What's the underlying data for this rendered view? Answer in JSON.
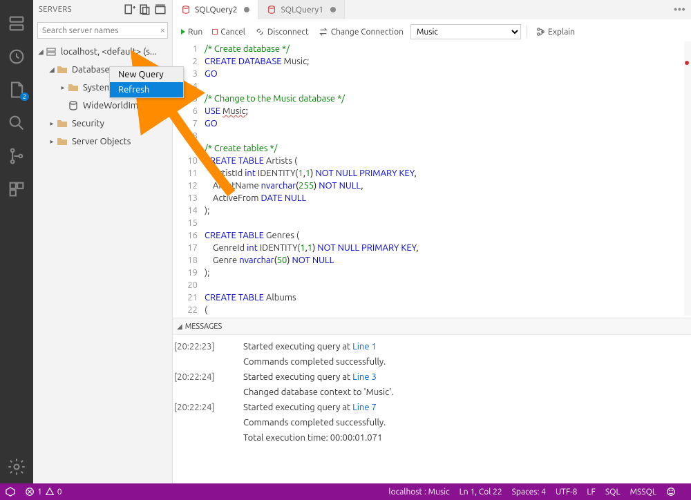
{
  "sidebar": {
    "title": "SERVERS",
    "search_placeholder": "Search server names",
    "tree": {
      "server": "localhost, <default> (s...",
      "databases": "Databases",
      "system": "System",
      "wwi": "WideWorldImpor",
      "security": "Security",
      "server_objects": "Server Objects"
    }
  },
  "activity_badge": "2",
  "context_menu": {
    "item0": "New Query",
    "item1": "Refresh"
  },
  "tabs": {
    "t0": "SQLQuery2",
    "t1": "SQLQuery1"
  },
  "toolbar": {
    "run": "Run",
    "cancel": "Cancel",
    "disconnect": "Disconnect",
    "change": "Change Connection",
    "explain": "Explain",
    "db": "Music"
  },
  "code": {
    "lines": [
      "1",
      "2",
      "3",
      "4",
      "5",
      "6",
      "7",
      "8",
      "9",
      "10",
      "11",
      "12",
      "13",
      "14",
      "15",
      "16",
      "17",
      "18",
      "19",
      "20",
      "21",
      "22"
    ],
    "l1": "/* Create database */",
    "l2a": "CREATE",
    "l2b": "DATABASE",
    "l2c": " Music;",
    "l3": "GO",
    "l5": "/* Change to the Music database */",
    "l6a": "USE",
    "l6b": " ",
    "l6c": "Music",
    "l6d": ";",
    "l7": "GO",
    "l9": "/* Create tables */",
    "l10a": "CREATE",
    "l10b": "TABLE",
    "l10c": " Artists (",
    "l11a": "    ArtistId ",
    "l11b": "int",
    "l11c": " IDENTITY(",
    "l11d": "1",
    "l11e": ",",
    "l11f": "1",
    "l11g": ") ",
    "l11h": "NOT NULL PRIMARY KEY",
    "l11i": ",",
    "l12a": "    ArtistName ",
    "l12b": "nvarchar",
    "l12c": "(",
    "l12d": "255",
    "l12e": ") ",
    "l12f": "NOT NULL",
    "l12g": ",",
    "l13a": "    ActiveFrom ",
    "l13b": "DATE NULL",
    "l14": ");",
    "l16a": "CREATE",
    "l16b": "TABLE",
    "l16c": " Genres (",
    "l17a": "    GenreId ",
    "l17b": "int",
    "l17c": " IDENTITY(",
    "l17d": "1",
    "l17e": ",",
    "l17f": "1",
    "l17g": ") ",
    "l17h": "NOT NULL PRIMARY KEY",
    "l17i": ",",
    "l18a": "    Genre ",
    "l18b": "nvarchar",
    "l18c": "(",
    "l18d": "50",
    "l18e": ") ",
    "l18f": "NOT NULL",
    "l19": ");",
    "l21a": "CREATE",
    "l21b": "TABLE",
    "l21c": " Albums",
    "l22": "("
  },
  "messages": {
    "header": "MESSAGES",
    "rows": [
      {
        "ts": "[20:22:23]",
        "text": "Started executing query at ",
        "link": "Line 1"
      },
      {
        "indent": "Commands completed successfully."
      },
      {
        "ts": "[20:22:24]",
        "text": "Started executing query at ",
        "link": "Line 3"
      },
      {
        "indent": "Changed database context to 'Music'."
      },
      {
        "ts": "[20:22:24]",
        "text": "Started executing query at ",
        "link": "Line 7"
      },
      {
        "indent": "Commands completed successfully."
      },
      {
        "indent": "Total execution time: 00:00:01.071"
      }
    ]
  },
  "statusbar": {
    "errors": "1",
    "warnings": "0",
    "conn": "localhost : Music",
    "cursor": "Ln 1, Col 22",
    "spaces": "Spaces: 4",
    "encoding": "UTF-8",
    "eol": "LF",
    "lang": "SQL",
    "server": "MSSQL"
  }
}
